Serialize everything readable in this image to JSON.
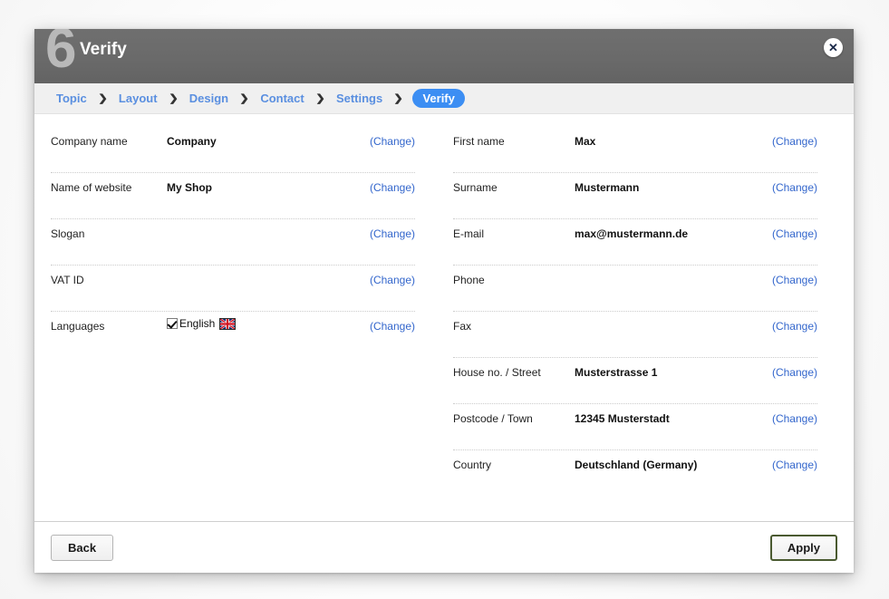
{
  "dialog": {
    "step_number": "6",
    "title": "Verify",
    "close_icon": "close-icon",
    "close_glyph": "✕"
  },
  "breadcrumb": {
    "separator": "❯",
    "items": [
      {
        "label": "Topic",
        "active": false
      },
      {
        "label": "Layout",
        "active": false
      },
      {
        "label": "Design",
        "active": false
      },
      {
        "label": "Contact",
        "active": false
      },
      {
        "label": "Settings",
        "active": false
      },
      {
        "label": "Verify",
        "active": true
      }
    ]
  },
  "change_label": "(Change)",
  "left_column": {
    "rows": [
      {
        "label": "Company name",
        "value": "Company"
      },
      {
        "label": "Name of website",
        "value": "My Shop"
      },
      {
        "label": "Slogan",
        "value": ""
      },
      {
        "label": "VAT ID",
        "value": ""
      }
    ],
    "languages_row": {
      "label": "Languages",
      "checked": true,
      "language_name": "English",
      "flag_icon": "uk-flag-icon"
    }
  },
  "right_column": {
    "rows": [
      {
        "label": "First name",
        "value": "Max"
      },
      {
        "label": "Surname",
        "value": "Mustermann"
      },
      {
        "label": "E-mail",
        "value": "max@mustermann.de"
      },
      {
        "label": "Phone",
        "value": ""
      },
      {
        "label": "Fax",
        "value": ""
      },
      {
        "label": "House no. / Street",
        "value": "Musterstrasse 1"
      },
      {
        "label": "Postcode / Town",
        "value": "12345 Musterstadt"
      },
      {
        "label": "Country",
        "value": "Deutschland (Germany)"
      }
    ]
  },
  "footer": {
    "back_label": "Back",
    "apply_label": "Apply"
  },
  "colors": {
    "header_gray": "#6a6a6a",
    "step_number_gray": "#b9b9b9",
    "breadcrumb_bg": "#f0f0f0",
    "crumb_link": "#5a8fe0",
    "crumb_active_bg": "#3c8ef3",
    "change_link": "#3366cc",
    "apply_border": "#4a5a30"
  }
}
